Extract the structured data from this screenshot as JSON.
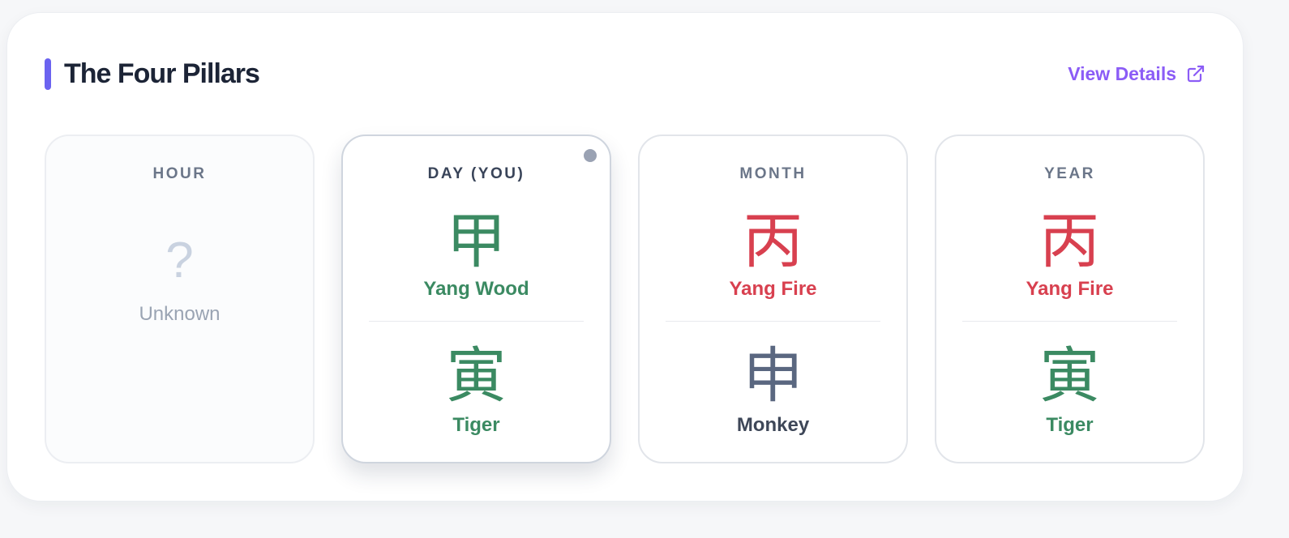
{
  "section": {
    "title": "The Four Pillars",
    "view_details_label": "View Details",
    "accent_color": "#6b63f0",
    "link_color": "#8b5cf6",
    "link_icon": "external-link-icon"
  },
  "colors": {
    "wood": "#3b8a62",
    "fire": "#d8404f",
    "metal": "#5a6780",
    "unknown": "#c9d2e0"
  },
  "pillars": [
    {
      "label": "HOUR",
      "unknown_symbol": "?",
      "unknown_text": "Unknown"
    },
    {
      "label": "DAY (YOU)",
      "stem_char": "甲",
      "stem_name": "Yang Wood",
      "stem_color": "#3b8a62",
      "branch_char": "寅",
      "branch_name": "Tiger",
      "branch_color": "#3b8a62"
    },
    {
      "label": "MONTH",
      "stem_char": "丙",
      "stem_name": "Yang Fire",
      "stem_color": "#d8404f",
      "branch_char": "申",
      "branch_char_color": "#5a6780",
      "branch_name": "Monkey",
      "branch_color": "#3e4758"
    },
    {
      "label": "YEAR",
      "stem_char": "丙",
      "stem_name": "Yang Fire",
      "stem_color": "#d8404f",
      "branch_char": "寅",
      "branch_name": "Tiger",
      "branch_color": "#3b8a62"
    }
  ]
}
